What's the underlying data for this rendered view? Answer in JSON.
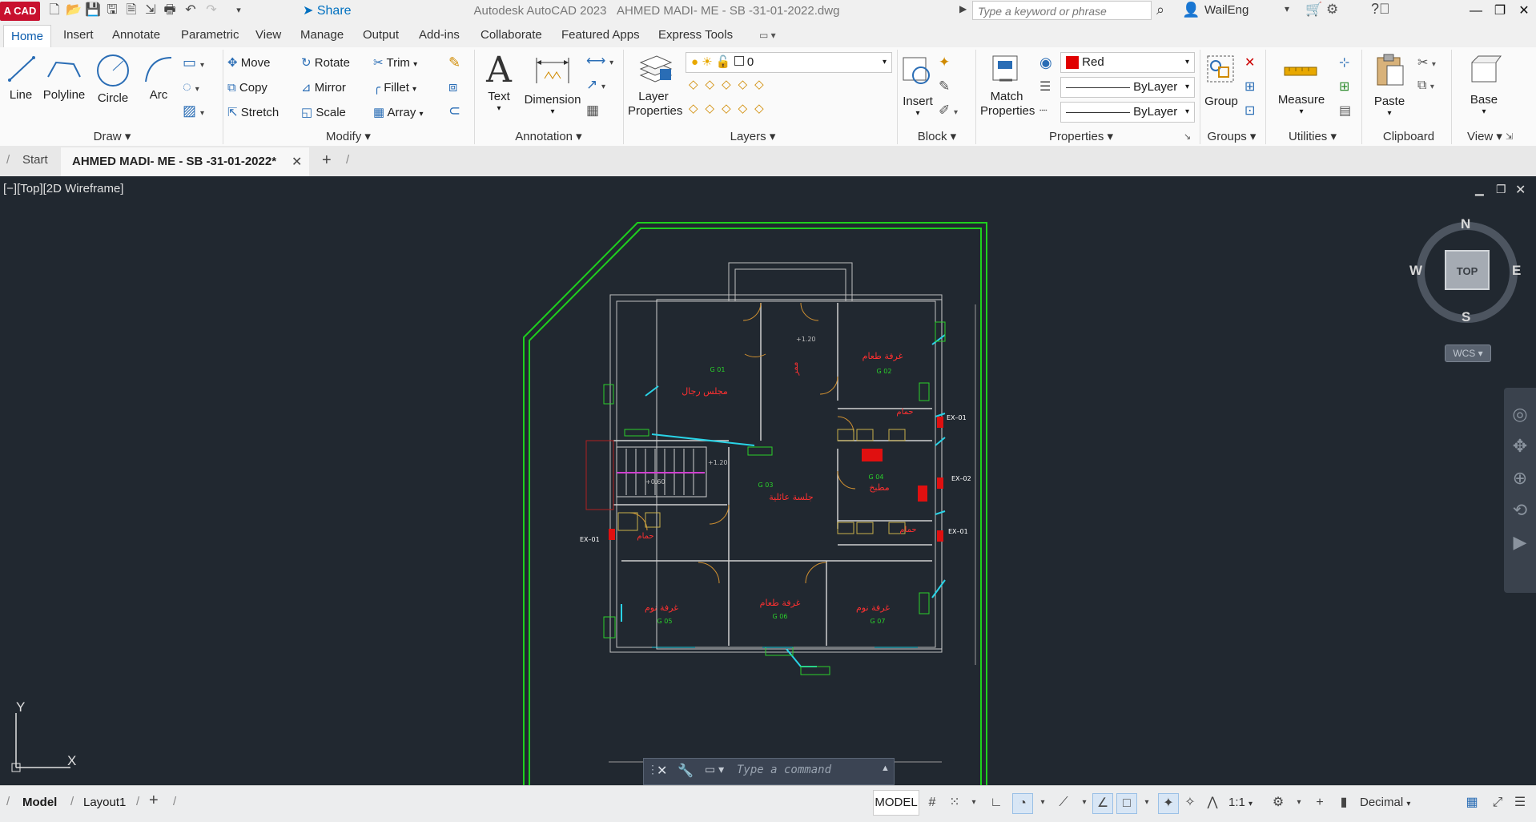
{
  "app": {
    "logo_text": "A CAD",
    "title": "Autodesk AutoCAD 2023",
    "document_title": "AHMED MADI- ME - SB -31-01-2022.dwg",
    "share_label": "Share",
    "search_placeholder": "Type a keyword or phrase",
    "user_name": "WailEng"
  },
  "ribbon_tabs": [
    "Home",
    "Insert",
    "Annotate",
    "Parametric",
    "View",
    "Manage",
    "Output",
    "Add-ins",
    "Collaborate",
    "Featured Apps",
    "Express Tools"
  ],
  "draw": {
    "title": "Draw",
    "line": "Line",
    "polyline": "Polyline",
    "circle": "Circle",
    "arc": "Arc"
  },
  "modify": {
    "title": "Modify",
    "move": "Move",
    "rotate": "Rotate",
    "trim": "Trim",
    "copy": "Copy",
    "mirror": "Mirror",
    "fillet": "Fillet",
    "stretch": "Stretch",
    "scale": "Scale",
    "array": "Array"
  },
  "annotation": {
    "title": "Annotation",
    "text": "Text",
    "dimension": "Dimension"
  },
  "layers": {
    "title": "Layers",
    "layer_properties_line1": "Layer",
    "layer_properties_line2": "Properties",
    "current_layer": "0"
  },
  "block": {
    "title": "Block",
    "insert": "Insert"
  },
  "properties": {
    "title": "Properties",
    "match_line1": "Match",
    "match_line2": "Properties",
    "color": "Red",
    "color_hex": "#e00000",
    "linetype": "ByLayer",
    "lineweight": "ByLayer"
  },
  "groups": {
    "title": "Groups",
    "group": "Group"
  },
  "utilities": {
    "title": "Utilities",
    "measure": "Measure"
  },
  "clipboard": {
    "title": "Clipboard",
    "paste": "Paste"
  },
  "view": {
    "title": "View",
    "base": "Base"
  },
  "file_tabs": {
    "start": "Start",
    "active": "AHMED MADI- ME - SB -31-01-2022*"
  },
  "viewport": {
    "label": "[−][Top][2D Wireframe]",
    "viewcube_top": "TOP",
    "compass_n": "N",
    "compass_s": "S",
    "compass_e": "E",
    "compass_w": "W",
    "wcs": "WCS",
    "ucs_x": "X",
    "ucs_y": "Y"
  },
  "drawing": {
    "rooms": [
      {
        "name": "مجلس رجال",
        "code": "G 01"
      },
      {
        "name": "غرفة طعام",
        "code": "G 02"
      },
      {
        "name": "جلسة عائلية",
        "code": "G 03"
      },
      {
        "name": "مطبخ",
        "code": "G 04"
      },
      {
        "name": "غرفة نوم",
        "code": "G 05"
      },
      {
        "name": "غرفة طعام",
        "code": "G 06"
      },
      {
        "name": "غرفة نوم",
        "code": "G 07"
      }
    ],
    "bath_label": "حمام",
    "corridor_label": "ممر",
    "ex01": "EX–01",
    "ex02": "EX–02",
    "level_1": "+1.20",
    "level_2": "+1.20",
    "level_3": "+0.60"
  },
  "command": {
    "placeholder": "Type a command"
  },
  "status": {
    "model_tab": "Model",
    "layout_tab": "Layout1",
    "model_label": "MODEL",
    "scale": "1:1",
    "units": "Decimal"
  }
}
